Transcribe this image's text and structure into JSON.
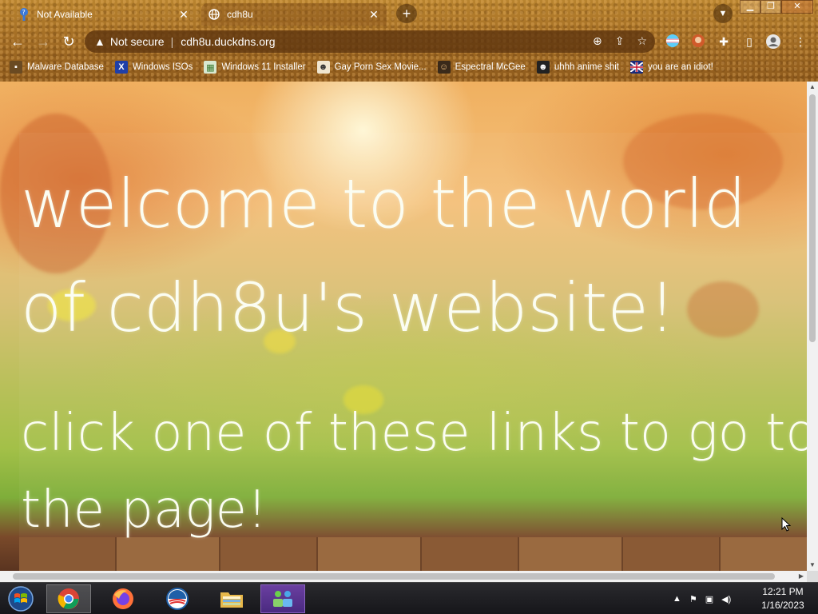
{
  "browser": {
    "tabs": [
      {
        "title": "Not Available",
        "active": false,
        "icon": "help-icon"
      },
      {
        "title": "cdh8u",
        "active": true,
        "icon": "globe-icon"
      }
    ],
    "new_tab_symbol": "+",
    "address": {
      "security_label": "Not secure",
      "url": "cdh8u.duckdns.org"
    },
    "bookmarks": [
      {
        "label": "Malware Database",
        "icon": "bookmark-icon"
      },
      {
        "label": "Windows ISOs",
        "icon": "x-icon"
      },
      {
        "label": "Windows 11 Installer",
        "icon": "image-icon"
      },
      {
        "label": "Gay Porn Sex Movie...",
        "icon": "site-icon"
      },
      {
        "label": "Espectral McGee",
        "icon": "site-icon"
      },
      {
        "label": "uhhh anime shit",
        "icon": "anime-icon"
      },
      {
        "label": "you are an idiot!",
        "icon": "flag-icon"
      }
    ]
  },
  "page": {
    "heading": "welcome to the world of cdh8u's website!",
    "subheading": "click one of these links to go to the page!"
  },
  "taskbar": {
    "clock_time": "12:21 PM",
    "clock_date": "1/16/2023",
    "apps": [
      "chrome-icon",
      "firefox-icon",
      "obama-icon",
      "file-explorer-icon",
      "network-app-icon"
    ]
  },
  "colors": {
    "chrome_brown": "#a46e25",
    "heading_text": "#fbfdf2",
    "taskbar": "#1e1e22"
  }
}
